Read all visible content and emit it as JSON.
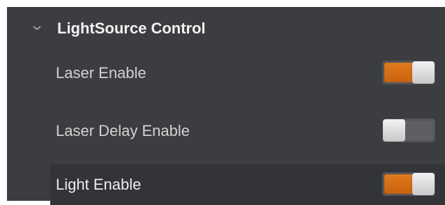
{
  "section": {
    "title": "LightSource Control",
    "expanded": true,
    "icon": "chevron-down-icon"
  },
  "rows": [
    {
      "label": "Laser Enable",
      "enabled": true
    },
    {
      "label": "Laser Delay Enable",
      "enabled": false
    },
    {
      "label": "Light Enable",
      "enabled": true,
      "selected": true
    }
  ],
  "colors": {
    "toggle_on": "#d86e16",
    "toggle_off": "#5e5f62",
    "panel_bg": "#3c3d40"
  }
}
